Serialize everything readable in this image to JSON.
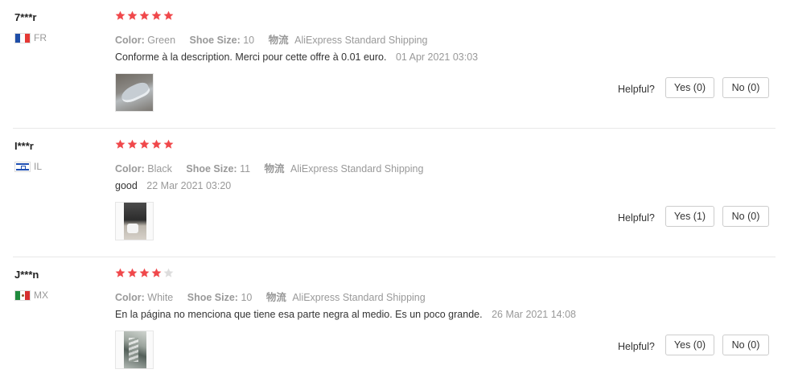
{
  "colors": {
    "star_filled": "#f0484b",
    "star_empty": "#dddddd",
    "muted": "#999999"
  },
  "helpful_label": "Helpful?",
  "reviews": [
    {
      "user": "7***r",
      "country": "FR",
      "flag": "france-flag-icon",
      "rating": 5,
      "color_label": "Color:",
      "color_value": "Green",
      "size_label": "Shoe Size:",
      "size_value": "10",
      "shipping_label": "物流",
      "shipping_value": "AliExpress Standard Shipping",
      "text": "Conforme à la description. Merci pour cette offre à 0.01 euro.",
      "date": "01 Apr 2021 03:03",
      "yes": "Yes (0)",
      "no": "No (0)"
    },
    {
      "user": "I***r",
      "country": "IL",
      "flag": "israel-flag-icon",
      "rating": 5,
      "color_label": "Color:",
      "color_value": "Black",
      "size_label": "Shoe Size:",
      "size_value": "11",
      "shipping_label": "物流",
      "shipping_value": "AliExpress Standard Shipping",
      "text": "good",
      "date": "22 Mar 2021 03:20",
      "yes": "Yes (1)",
      "no": "No (0)"
    },
    {
      "user": "J***n",
      "country": "MX",
      "flag": "mexico-flag-icon",
      "rating": 4,
      "color_label": "Color:",
      "color_value": "White",
      "size_label": "Shoe Size:",
      "size_value": "10",
      "shipping_label": "物流",
      "shipping_value": "AliExpress Standard Shipping",
      "text": "En la página no menciona que tiene esa parte negra al medio. Es un poco grande.",
      "date": "26 Mar 2021 14:08",
      "yes": "Yes (0)",
      "no": "No (0)"
    }
  ]
}
